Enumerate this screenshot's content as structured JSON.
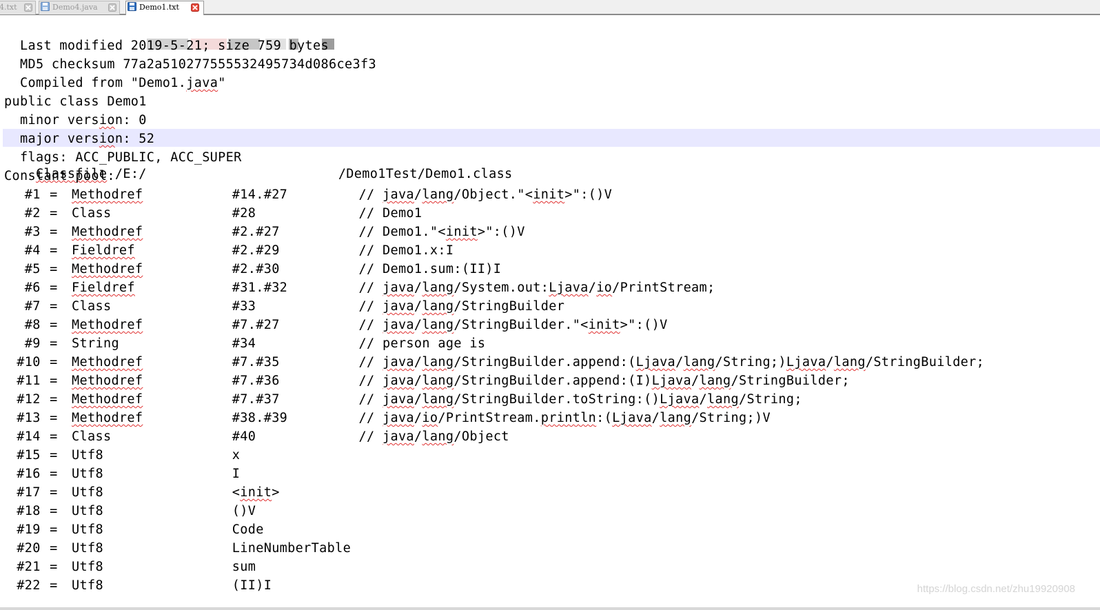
{
  "tabs": [
    {
      "label": "4.txt"
    },
    {
      "label": "Demo4.java"
    },
    {
      "label": "Demo1.txt"
    }
  ],
  "editor": {
    "classfile_prefix": "Classfile /E:/",
    "classfile_suffix": "/Demo1Test/Demo1.class",
    "header_lines": [
      "  Last modified 2019-5-21; size 759 bytes",
      "  MD5 checksum 77a2a510277555532495734d086ce3f3",
      "  Compiled from \"Demo1.java\"",
      "public class Demo1",
      "  minor version: 0",
      "  major version: 52",
      "  flags: ACC_PUBLIC, ACC_SUPER",
      "Constant pool:"
    ],
    "pool": [
      {
        "idx": "#1",
        "type": "Methodref",
        "ref": "#14.#27",
        "comment": "// java/lang/Object.\"<init>\":()V"
      },
      {
        "idx": "#2",
        "type": "Class",
        "ref": "#28",
        "comment": "// Demo1"
      },
      {
        "idx": "#3",
        "type": "Methodref",
        "ref": "#2.#27",
        "comment": "// Demo1.\"<init>\":()V"
      },
      {
        "idx": "#4",
        "type": "Fieldref",
        "ref": "#2.#29",
        "comment": "// Demo1.x:I"
      },
      {
        "idx": "#5",
        "type": "Methodref",
        "ref": "#2.#30",
        "comment": "// Demo1.sum:(II)I"
      },
      {
        "idx": "#6",
        "type": "Fieldref",
        "ref": "#31.#32",
        "comment": "// java/lang/System.out:Ljava/io/PrintStream;"
      },
      {
        "idx": "#7",
        "type": "Class",
        "ref": "#33",
        "comment": "// java/lang/StringBuilder"
      },
      {
        "idx": "#8",
        "type": "Methodref",
        "ref": "#7.#27",
        "comment": "// java/lang/StringBuilder.\"<init>\":()V"
      },
      {
        "idx": "#9",
        "type": "String",
        "ref": "#34",
        "comment": "// person age is"
      },
      {
        "idx": "#10",
        "type": "Methodref",
        "ref": "#7.#35",
        "comment": "// java/lang/StringBuilder.append:(Ljava/lang/String;)Ljava/lang/StringBuilder;"
      },
      {
        "idx": "#11",
        "type": "Methodref",
        "ref": "#7.#36",
        "comment": "// java/lang/StringBuilder.append:(I)Ljava/lang/StringBuilder;"
      },
      {
        "idx": "#12",
        "type": "Methodref",
        "ref": "#7.#37",
        "comment": "// java/lang/StringBuilder.toString:()Ljava/lang/String;"
      },
      {
        "idx": "#13",
        "type": "Methodref",
        "ref": "#38.#39",
        "comment": "// java/io/PrintStream.println:(Ljava/lang/String;)V"
      },
      {
        "idx": "#14",
        "type": "Class",
        "ref": "#40",
        "comment": "// java/lang/Object"
      },
      {
        "idx": "#15",
        "type": "Utf8",
        "ref": "x",
        "comment": ""
      },
      {
        "idx": "#16",
        "type": "Utf8",
        "ref": "I",
        "comment": ""
      },
      {
        "idx": "#17",
        "type": "Utf8",
        "ref": "<init>",
        "comment": ""
      },
      {
        "idx": "#18",
        "type": "Utf8",
        "ref": "()V",
        "comment": ""
      },
      {
        "idx": "#19",
        "type": "Utf8",
        "ref": "Code",
        "comment": ""
      },
      {
        "idx": "#20",
        "type": "Utf8",
        "ref": "LineNumberTable",
        "comment": ""
      },
      {
        "idx": "#21",
        "type": "Utf8",
        "ref": "sum",
        "comment": ""
      },
      {
        "idx": "#22",
        "type": "Utf8",
        "ref": "(II)I",
        "comment": ""
      }
    ],
    "squiggle_words": [
      "Classfile",
      "java",
      "lang",
      "io",
      "Methodref",
      "Fieldref",
      "init",
      "Ljava",
      "println"
    ]
  },
  "watermark": "https://blog.csdn.net/zhu19920908",
  "colors": {
    "highlight_line": "#e8e8ff",
    "squiggle": "#e03030",
    "save_icon": "#2f6fc0"
  },
  "icons": {
    "tab_file": "save-disk-icon",
    "tab_close": "close-x-icon"
  }
}
